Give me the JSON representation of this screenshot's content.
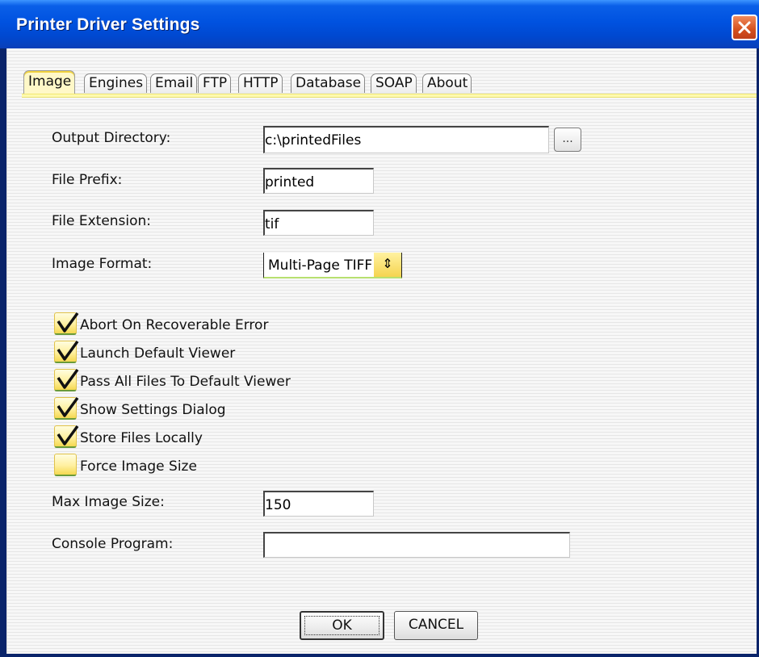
{
  "window": {
    "title": "Printer Driver Settings"
  },
  "tabs": [
    {
      "label": "Image",
      "active": true
    },
    {
      "label": "Engines",
      "active": false
    },
    {
      "label": "Email",
      "active": false
    },
    {
      "label": "FTP",
      "active": false
    },
    {
      "label": "HTTP",
      "active": false
    },
    {
      "label": "Database",
      "active": false
    },
    {
      "label": "SOAP",
      "active": false
    },
    {
      "label": "About",
      "active": false
    }
  ],
  "form": {
    "output_directory": {
      "label": "Output Directory:",
      "value": "c:\\printedFiles",
      "browse_label": "..."
    },
    "file_prefix": {
      "label": "File Prefix:",
      "value": "printed"
    },
    "file_extension": {
      "label": "File Extension:",
      "value": "tif"
    },
    "image_format": {
      "label": "Image Format:",
      "value": "Multi-Page TIFF"
    },
    "max_image_size": {
      "label": "Max Image Size:",
      "value": "150"
    },
    "console_program": {
      "label": "Console Program:",
      "value": ""
    }
  },
  "checkboxes": [
    {
      "label": "Abort On Recoverable Error",
      "checked": true
    },
    {
      "label": "Launch Default Viewer",
      "checked": true
    },
    {
      "label": "Pass All Files To Default Viewer",
      "checked": true
    },
    {
      "label": "Show Settings Dialog",
      "checked": true
    },
    {
      "label": "Store Files Locally",
      "checked": true
    },
    {
      "label": "Force Image Size",
      "checked": false
    }
  ],
  "buttons": {
    "ok": "OK",
    "cancel": "CANCEL"
  },
  "icons": {
    "close": "close-icon",
    "check": "checkmark-icon",
    "select_arrow": "updown-arrow-icon"
  },
  "colors": {
    "titlebar": "#0052e0",
    "close_button": "#d4501e",
    "tab_active": "#fff8c8",
    "checkbox_fill": "#fff0a0"
  }
}
